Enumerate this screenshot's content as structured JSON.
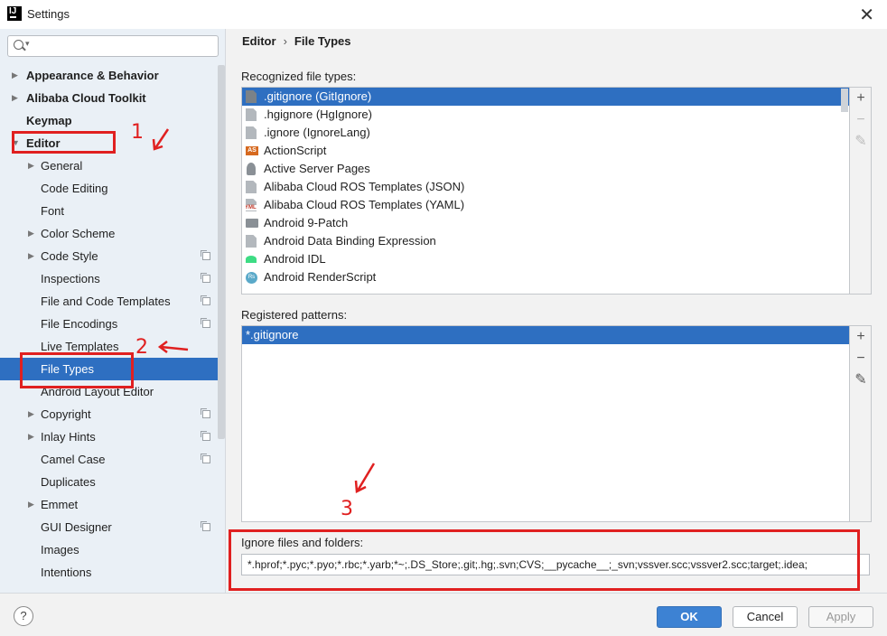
{
  "window": {
    "title": "Settings",
    "app_icon": "IJ"
  },
  "search": {
    "placeholder": ""
  },
  "sidebar": {
    "items": [
      {
        "label": "Appearance & Behavior",
        "level": 0,
        "expandable": true
      },
      {
        "label": "Alibaba Cloud Toolkit",
        "level": 0,
        "expandable": true
      },
      {
        "label": "Keymap",
        "level": 0,
        "expandable": false
      },
      {
        "label": "Editor",
        "level": 0,
        "expanded": true
      },
      {
        "label": "General",
        "level": 1,
        "expandable": true
      },
      {
        "label": "Code Editing",
        "level": 1
      },
      {
        "label": "Font",
        "level": 1
      },
      {
        "label": "Color Scheme",
        "level": 1,
        "expandable": true
      },
      {
        "label": "Code Style",
        "level": 1,
        "expandable": true,
        "project": true
      },
      {
        "label": "Inspections",
        "level": 1,
        "project": true
      },
      {
        "label": "File and Code Templates",
        "level": 1,
        "project": true
      },
      {
        "label": "File Encodings",
        "level": 1,
        "project": true
      },
      {
        "label": "Live Templates",
        "level": 1
      },
      {
        "label": "File Types",
        "level": 1,
        "selected": true
      },
      {
        "label": "Android Layout Editor",
        "level": 1
      },
      {
        "label": "Copyright",
        "level": 1,
        "expandable": true,
        "project": true
      },
      {
        "label": "Inlay Hints",
        "level": 1,
        "expandable": true,
        "project": true
      },
      {
        "label": "Camel Case",
        "level": 1,
        "project": true
      },
      {
        "label": "Duplicates",
        "level": 1
      },
      {
        "label": "Emmet",
        "level": 1,
        "expandable": true
      },
      {
        "label": "GUI Designer",
        "level": 1,
        "project": true
      },
      {
        "label": "Images",
        "level": 1
      },
      {
        "label": "Intentions",
        "level": 1
      }
    ]
  },
  "breadcrumb": {
    "parent": "Editor",
    "separator": "›",
    "current": "File Types"
  },
  "recognized": {
    "label": "Recognized file types:",
    "items": [
      {
        "name": ".gitignore (GitIgnore)",
        "icon": "file-dark",
        "selected": true
      },
      {
        "name": ".hgignore (HgIgnore)",
        "icon": "file"
      },
      {
        "name": ".ignore (IgnoreLang)",
        "icon": "file"
      },
      {
        "name": "ActionScript",
        "icon": "as"
      },
      {
        "name": "Active Server Pages",
        "icon": "person"
      },
      {
        "name": "Alibaba Cloud ROS Templates (JSON)",
        "icon": "file"
      },
      {
        "name": "Alibaba Cloud ROS Templates (YAML)",
        "icon": "yml"
      },
      {
        "name": "Android 9-Patch",
        "icon": "folder"
      },
      {
        "name": "Android Data Binding Expression",
        "icon": "file"
      },
      {
        "name": "Android IDL",
        "icon": "android"
      },
      {
        "name": "Android RenderScript",
        "icon": "rs"
      }
    ]
  },
  "patterns": {
    "label": "Registered patterns:",
    "items": [
      {
        "name": "*.gitignore",
        "selected": true
      }
    ]
  },
  "toolbar": {
    "add": "+",
    "remove": "−",
    "edit": "✎"
  },
  "ignore": {
    "label": "Ignore files and folders:",
    "value": "*.hprof;*.pyc;*.pyo;*.rbc;*.yarb;*~;.DS_Store;.git;.hg;.svn;CVS;__pycache__;_svn;vssver.scc;vssver2.scc;target;.idea;"
  },
  "annotations": {
    "n1": "1",
    "n2": "2",
    "n3": "3",
    "color": "#e02020"
  },
  "buttons": {
    "help": "?",
    "ok": "OK",
    "cancel": "Cancel",
    "apply": "Apply"
  },
  "colors": {
    "selection": "#2e6fc1",
    "sidebar_bg": "#eaf0f6",
    "ok_button": "#3d82d3"
  }
}
